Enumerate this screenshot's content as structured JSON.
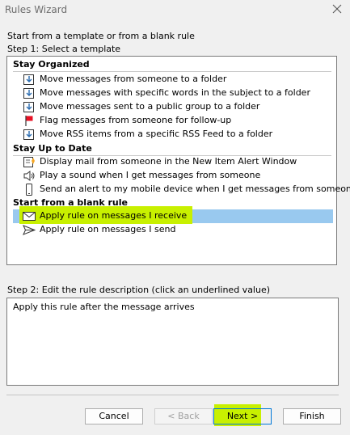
{
  "window": {
    "title": "Rules Wizard"
  },
  "intro_text": "Start from a template or from a blank rule",
  "step1_label": "Step 1: Select a template",
  "groups": [
    {
      "header": "Stay Organized",
      "items": [
        {
          "label": "Move messages from someone to a folder",
          "icon": "move-folder-icon"
        },
        {
          "label": "Move messages with specific words in the subject to a folder",
          "icon": "move-folder-icon"
        },
        {
          "label": "Move messages sent to a public group to a folder",
          "icon": "move-folder-icon"
        },
        {
          "label": "Flag messages from someone for follow-up",
          "icon": "red-flag-icon"
        },
        {
          "label": "Move RSS items from a specific RSS Feed to a folder",
          "icon": "move-folder-icon"
        }
      ]
    },
    {
      "header": "Stay Up to Date",
      "items": [
        {
          "label": "Display mail from someone in the New Item Alert Window",
          "icon": "new-item-alert-icon"
        },
        {
          "label": "Play a sound when I get messages from someone",
          "icon": "speaker-icon"
        },
        {
          "label": "Send an alert to my mobile device when I get messages from someone",
          "icon": "mobile-device-icon"
        }
      ]
    },
    {
      "header": "Start from a blank rule",
      "items": [
        {
          "label": "Apply rule on messages I receive",
          "icon": "envelope-icon",
          "selected": true
        },
        {
          "label": "Apply rule on messages I send",
          "icon": "send-icon"
        }
      ]
    }
  ],
  "step2_label": "Step 2: Edit the rule description (click an underlined value)",
  "description": "Apply this rule after the message arrives",
  "buttons": {
    "cancel": "Cancel",
    "back": "< Back",
    "next": "Next >",
    "finish": "Finish"
  },
  "colors": {
    "selection": "#99c9ef",
    "highlight": "#c8f000",
    "flag": "#e81123",
    "icon_blue": "#2b6cb0"
  }
}
